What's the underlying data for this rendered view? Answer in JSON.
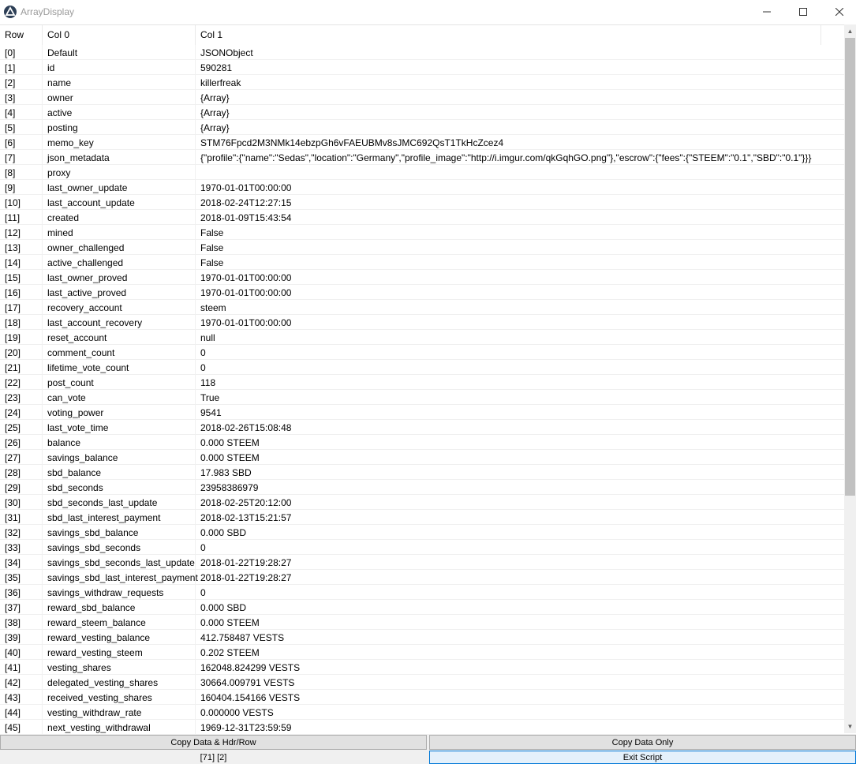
{
  "window": {
    "title": "ArrayDisplay"
  },
  "columns": {
    "row": "Row",
    "col0": "Col 0",
    "col1": "Col 1"
  },
  "rows": [
    {
      "idx": "[0]",
      "key": "Default",
      "val": "JSONObject"
    },
    {
      "idx": "[1]",
      "key": "id",
      "val": "590281"
    },
    {
      "idx": "[2]",
      "key": "name",
      "val": "killerfreak"
    },
    {
      "idx": "[3]",
      "key": "owner",
      "val": "{Array}"
    },
    {
      "idx": "[4]",
      "key": "active",
      "val": "{Array}"
    },
    {
      "idx": "[5]",
      "key": "posting",
      "val": "{Array}"
    },
    {
      "idx": "[6]",
      "key": "memo_key",
      "val": "STM76Fpcd2M3NMk14ebzpGh6vFAEUBMv8sJMC692QsT1TkHcZcez4"
    },
    {
      "idx": "[7]",
      "key": "json_metadata",
      "val": "{\"profile\":{\"name\":\"Sedas\",\"location\":\"Germany\",\"profile_image\":\"http://i.imgur.com/qkGqhGO.png\"},\"escrow\":{\"fees\":{\"STEEM\":\"0.1\",\"SBD\":\"0.1\"}}}"
    },
    {
      "idx": "[8]",
      "key": "proxy",
      "val": ""
    },
    {
      "idx": "[9]",
      "key": "last_owner_update",
      "val": "1970-01-01T00:00:00"
    },
    {
      "idx": "[10]",
      "key": "last_account_update",
      "val": "2018-02-24T12:27:15"
    },
    {
      "idx": "[11]",
      "key": "created",
      "val": "2018-01-09T15:43:54"
    },
    {
      "idx": "[12]",
      "key": "mined",
      "val": "False"
    },
    {
      "idx": "[13]",
      "key": "owner_challenged",
      "val": "False"
    },
    {
      "idx": "[14]",
      "key": "active_challenged",
      "val": "False"
    },
    {
      "idx": "[15]",
      "key": "last_owner_proved",
      "val": "1970-01-01T00:00:00"
    },
    {
      "idx": "[16]",
      "key": "last_active_proved",
      "val": "1970-01-01T00:00:00"
    },
    {
      "idx": "[17]",
      "key": "recovery_account",
      "val": "steem"
    },
    {
      "idx": "[18]",
      "key": "last_account_recovery",
      "val": "1970-01-01T00:00:00"
    },
    {
      "idx": "[19]",
      "key": "reset_account",
      "val": "null"
    },
    {
      "idx": "[20]",
      "key": "comment_count",
      "val": "0"
    },
    {
      "idx": "[21]",
      "key": "lifetime_vote_count",
      "val": "0"
    },
    {
      "idx": "[22]",
      "key": "post_count",
      "val": "118"
    },
    {
      "idx": "[23]",
      "key": "can_vote",
      "val": "True"
    },
    {
      "idx": "[24]",
      "key": "voting_power",
      "val": "9541"
    },
    {
      "idx": "[25]",
      "key": "last_vote_time",
      "val": "2018-02-26T15:08:48"
    },
    {
      "idx": "[26]",
      "key": "balance",
      "val": "0.000 STEEM"
    },
    {
      "idx": "[27]",
      "key": "savings_balance",
      "val": "0.000 STEEM"
    },
    {
      "idx": "[28]",
      "key": "sbd_balance",
      "val": "17.983 SBD"
    },
    {
      "idx": "[29]",
      "key": "sbd_seconds",
      "val": "23958386979"
    },
    {
      "idx": "[30]",
      "key": "sbd_seconds_last_update",
      "val": "2018-02-25T20:12:00"
    },
    {
      "idx": "[31]",
      "key": "sbd_last_interest_payment",
      "val": "2018-02-13T15:21:57"
    },
    {
      "idx": "[32]",
      "key": "savings_sbd_balance",
      "val": "0.000 SBD"
    },
    {
      "idx": "[33]",
      "key": "savings_sbd_seconds",
      "val": "0"
    },
    {
      "idx": "[34]",
      "key": "savings_sbd_seconds_last_update",
      "val": "2018-01-22T19:28:27"
    },
    {
      "idx": "[35]",
      "key": "savings_sbd_last_interest_payment",
      "val": "2018-01-22T19:28:27"
    },
    {
      "idx": "[36]",
      "key": "savings_withdraw_requests",
      "val": "0"
    },
    {
      "idx": "[37]",
      "key": "reward_sbd_balance",
      "val": "0.000 SBD"
    },
    {
      "idx": "[38]",
      "key": "reward_steem_balance",
      "val": "0.000 STEEM"
    },
    {
      "idx": "[39]",
      "key": "reward_vesting_balance",
      "val": "412.758487 VESTS"
    },
    {
      "idx": "[40]",
      "key": "reward_vesting_steem",
      "val": "0.202 STEEM"
    },
    {
      "idx": "[41]",
      "key": "vesting_shares",
      "val": "162048.824299 VESTS"
    },
    {
      "idx": "[42]",
      "key": "delegated_vesting_shares",
      "val": "30664.009791 VESTS"
    },
    {
      "idx": "[43]",
      "key": "received_vesting_shares",
      "val": "160404.154166 VESTS"
    },
    {
      "idx": "[44]",
      "key": "vesting_withdraw_rate",
      "val": "0.000000 VESTS"
    },
    {
      "idx": "[45]",
      "key": "next_vesting_withdrawal",
      "val": "1969-12-31T23:59:59"
    }
  ],
  "buttons": {
    "copy_hdr": "Copy Data & Hdr/Row",
    "copy_only": "Copy Data Only",
    "exit": "Exit Script"
  },
  "status": "[71] [2]",
  "icons": {
    "app": "autoit-icon",
    "min": "minimize-icon",
    "max": "maximize-icon",
    "close": "close-icon"
  }
}
